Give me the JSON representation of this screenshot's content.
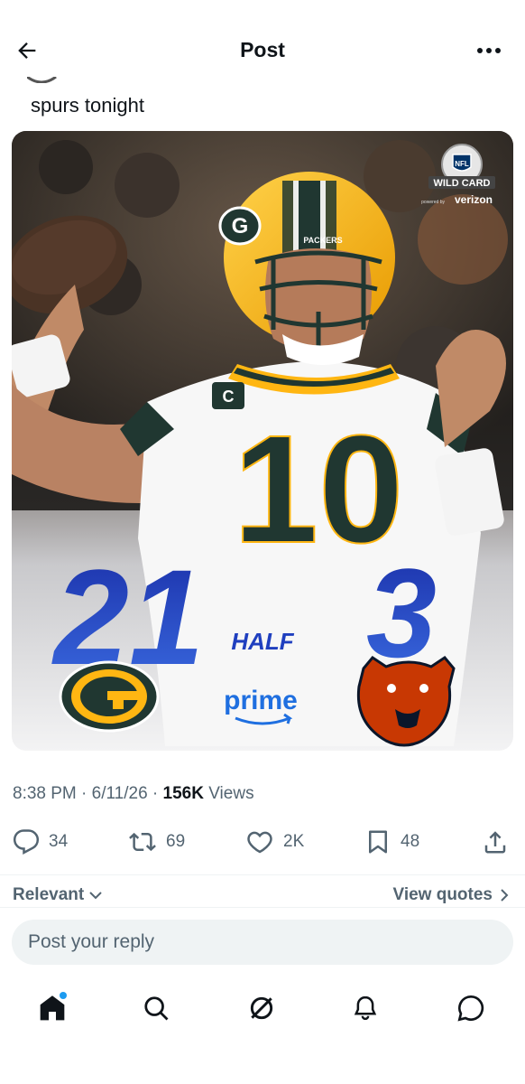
{
  "header": {
    "title": "Post",
    "back_icon": "arrow-left-icon",
    "more_icon": "more-horizontal-icon"
  },
  "tweet": {
    "text": "spurs tonight"
  },
  "media": {
    "badge_line1": "NFL",
    "badge_line2": "WILD CARD",
    "badge_line3": "powered by",
    "badge_sponsor": "verizon",
    "helmet_text": "PACKERS",
    "jersey_number": "10",
    "captain_patch": "C",
    "home_score": "21",
    "away_score": "3",
    "period": "HALF",
    "broadcaster": "prime",
    "colors": {
      "packers_green": "#203731",
      "packers_gold": "#FFB612",
      "score_blue": "#1f3fbf",
      "bears_orange": "#C83803"
    }
  },
  "meta": {
    "time": "8:38 PM",
    "sep1": " · ",
    "date": "6/11/26",
    "sep2": " · ",
    "views_count": "156K",
    "views_label": " Views"
  },
  "actions": {
    "replies": "34",
    "reposts": "69",
    "likes": "2K",
    "bookmarks": "48"
  },
  "replies_filter": {
    "sort_label": "Relevant",
    "view_quotes_label": "View quotes"
  },
  "reply": {
    "placeholder": "Post your reply"
  },
  "tabbar": {
    "items": [
      "home-icon",
      "search-icon",
      "grok-icon",
      "notifications-icon",
      "messages-icon"
    ]
  },
  "colors": {
    "text_primary": "#0f1419",
    "text_secondary": "#536471",
    "accent": "#1d9bf0",
    "divider": "#eff3f4"
  }
}
